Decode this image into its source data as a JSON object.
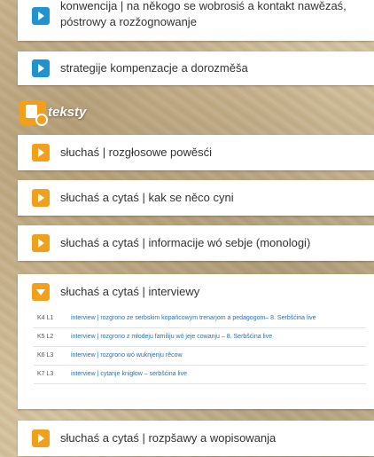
{
  "items_before": [
    {
      "label_line1": "konwencija | na někogo se wobrosiś a kontakt nawězaś,",
      "label_line2": "póstrowy a rozžognowanje",
      "color": "#1f93d1"
    },
    {
      "label": "strategije kompenzacje a dorozměša",
      "color": "#1f93d1"
    }
  ],
  "section": {
    "title": "teksty",
    "icon": "texts-icon"
  },
  "items_section": [
    {
      "label": "słuchaś | rozgłosowe powěsći"
    },
    {
      "label": "słuchaś a cytaś | kak se něco cyni"
    },
    {
      "label": "słuchaś a cytaś | informacije wó sebje (monologi)"
    }
  ],
  "expanded": {
    "label": "słuchaś a cytaś | interviewy",
    "rows": [
      {
        "code": "K4 L1",
        "text": "interview | rozgrono ze serbskim kopańcowym trenarjom a pedagogom– 8. Serbšćina live"
      },
      {
        "code": "K5 L2",
        "text": "interview | rozgrono z młodeju familiju wó jeje cowanju – 8. Serbšćina live"
      },
      {
        "code": "K6 L3",
        "text": "interview | rozgrono wó wuknjenju rěcow"
      },
      {
        "code": "K7 L3",
        "text": "interview | cytanje knigłow – serbšćina live"
      }
    ]
  },
  "item_after": {
    "label": "słuchaś a cytaś | rozpšawy a wopisowanja"
  },
  "colors": {
    "blue": "#1f93d1",
    "orange": "#f0a01a"
  }
}
